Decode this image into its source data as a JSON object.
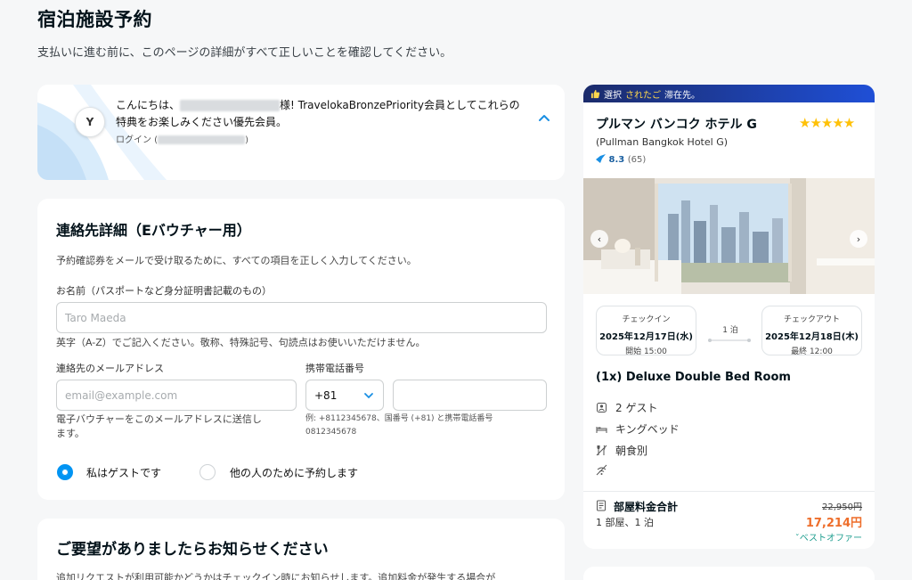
{
  "page": {
    "title": "宿泊施設予約",
    "subtitle": "支払いに進む前に、このページの詳細がすべて正しいことを確認してください。"
  },
  "greeting": {
    "avatar_letter": "Y",
    "hello": "こんにちは、",
    "suffix": "様! TravelokaBronzePriority会員としてこれらの",
    "line2": "特典をお楽しみください優先会員。",
    "login_prefix": "ログイン (",
    "login_suffix": ")"
  },
  "contact": {
    "heading": "連絡先詳細（Eバウチャー用）",
    "description": "予約確認券をメールで受け取るために、すべての項目を正しく入力してください。",
    "name_label": "お名前（パスポートなど身分証明書記載のもの）",
    "name_placeholder": "Taro Maeda",
    "name_hint": "英字（A-Z）でご記入ください。敬称、特殊記号、句読点はお使いいただけません。",
    "email_label": "連絡先のメールアドレス",
    "email_placeholder": "email@example.com",
    "email_hint_1": "電子バウチャーをこのメールアドレスに送信し",
    "email_hint_2": "ます。",
    "phone_label": "携帯電話番号",
    "phone_code": "+81",
    "phone_hint_1": "例: +8112345678、国番号 (+81) と携帯電話番号",
    "phone_hint_2": "0812345678",
    "radio_guest": "私はゲストです",
    "radio_other": "他の人のために予約します"
  },
  "requests": {
    "heading": "ご要望がありましたらお知らせください",
    "text": "追加リクエストが利用可能かどうかはチェックイン時にお知らせします。追加料金が発生する場合が"
  },
  "hotel": {
    "banner_prefix": "選択",
    "banner_highlight": "されたご",
    "banner_suffix": "滞在先。",
    "name": "プルマン バンコク ホテル G",
    "name_en": "(Pullman Bangkok Hotel G)",
    "stars": "★★★★★",
    "rating": "8.3",
    "rating_count": "(65)",
    "checkin_label": "チェックイン",
    "checkin_date": "2025年12月17日(水)",
    "checkin_time": "開始 15:00",
    "nights": "1 泊",
    "checkout_label": "チェックアウト",
    "checkout_date": "2025年12月18日(木)",
    "checkout_time": "最終 12:00",
    "room_title": "(1x) Deluxe Double Bed Room",
    "features": [
      "2 ゲスト",
      "キングベッド",
      "朝食別"
    ],
    "total_label": "部屋料金合計",
    "total_sub": "1 部屋、1 泊",
    "old_price": "22,950円",
    "new_price": "17,214円",
    "best_offer": "ベストオファー"
  }
}
